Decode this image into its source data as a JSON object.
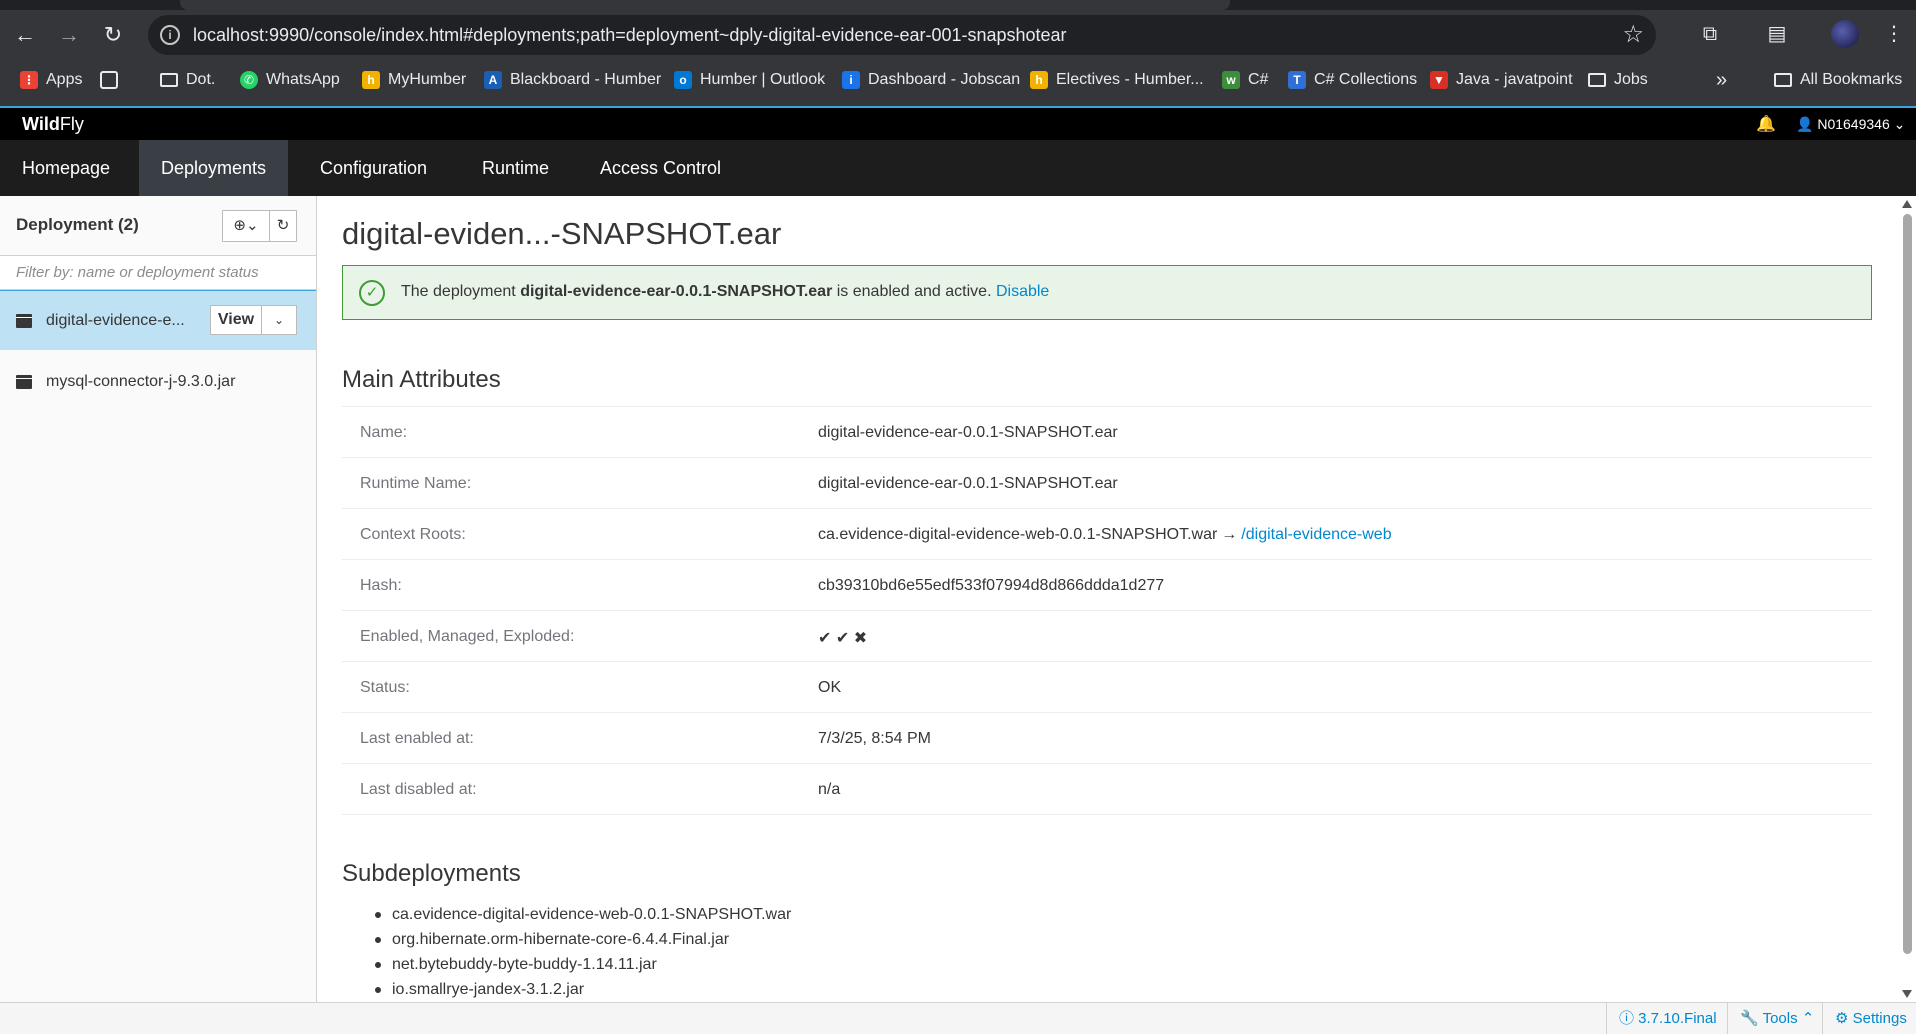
{
  "browser": {
    "url": "localhost:9990/console/index.html#deployments;path=deployment~dply-digital-evidence-ear-001-snapshotear",
    "bookmarks": [
      {
        "label": "Apps",
        "color": "#ea4335"
      },
      {
        "label": "Dot.",
        "color": "folder"
      },
      {
        "label": "WhatsApp",
        "color": "#25d366"
      },
      {
        "label": "MyHumber",
        "color": "#f2b200"
      },
      {
        "label": "Blackboard - Humber",
        "color": "#1a5fb4"
      },
      {
        "label": "Humber | Outlook",
        "color": "#0078d4"
      },
      {
        "label": "Dashboard - Jobscan",
        "color": "#1a73e8"
      },
      {
        "label": "Electives - Humber...",
        "color": "#f2b200"
      },
      {
        "label": "C#",
        "color": "#3c8d3c"
      },
      {
        "label": "C# Collections",
        "color": "#2f6fd6"
      },
      {
        "label": "Java - javatpoint",
        "color": "#d93025"
      },
      {
        "label": "Jobs",
        "color": "folder"
      }
    ],
    "more": "»",
    "all_bookmarks": "All Bookmarks"
  },
  "wildfly": {
    "logo_bold": "Wild",
    "logo_light": "Fly",
    "user": "N01649346",
    "nav": [
      "Homepage",
      "Deployments",
      "Configuration",
      "Runtime",
      "Access Control"
    ]
  },
  "sidebar": {
    "title": "Deployment (2)",
    "filter_placeholder": "Filter by: name or deployment status",
    "items": [
      {
        "label": "digital-evidence-e...",
        "view": "View"
      },
      {
        "label": "mysql-connector-j-9.3.0.jar"
      }
    ]
  },
  "main": {
    "title": "digital-eviden...-SNAPSHOT.ear",
    "alert": {
      "prefix": "The deployment ",
      "name": "digital-evidence-ear-0.0.1-SNAPSHOT.ear",
      "suffix": " is enabled and active. ",
      "link": "Disable"
    },
    "attributes_title": "Main Attributes",
    "attributes": [
      {
        "label": "Name:",
        "value": "digital-evidence-ear-0.0.1-SNAPSHOT.ear"
      },
      {
        "label": "Runtime Name:",
        "value": "digital-evidence-ear-0.0.1-SNAPSHOT.ear"
      },
      {
        "label": "Context Roots:",
        "value": "ca.evidence-digital-evidence-web-0.0.1-SNAPSHOT.war",
        "arrow": "→",
        "link": "/digital-evidence-web"
      },
      {
        "label": "Hash:",
        "value": "cb39310bd6e55edf533f07994d8d866ddda1d277"
      },
      {
        "label": "Enabled, Managed, Exploded:",
        "value": "✔ ✔ ✖"
      },
      {
        "label": "Status:",
        "value": "OK"
      },
      {
        "label": "Last enabled at:",
        "value": "7/3/25, 8:54 PM"
      },
      {
        "label": "Last disabled at:",
        "value": "n/a"
      }
    ],
    "subdeployments_title": "Subdeployments",
    "subdeployments": [
      "ca.evidence-digital-evidence-web-0.0.1-SNAPSHOT.war",
      "org.hibernate.orm-hibernate-core-6.4.4.Final.jar",
      "net.bytebuddy-byte-buddy-1.14.11.jar",
      "io.smallrye-jandex-3.1.2.jar"
    ]
  },
  "footer": {
    "version": "3.7.10.Final",
    "tools": "Tools",
    "settings": "Settings"
  }
}
